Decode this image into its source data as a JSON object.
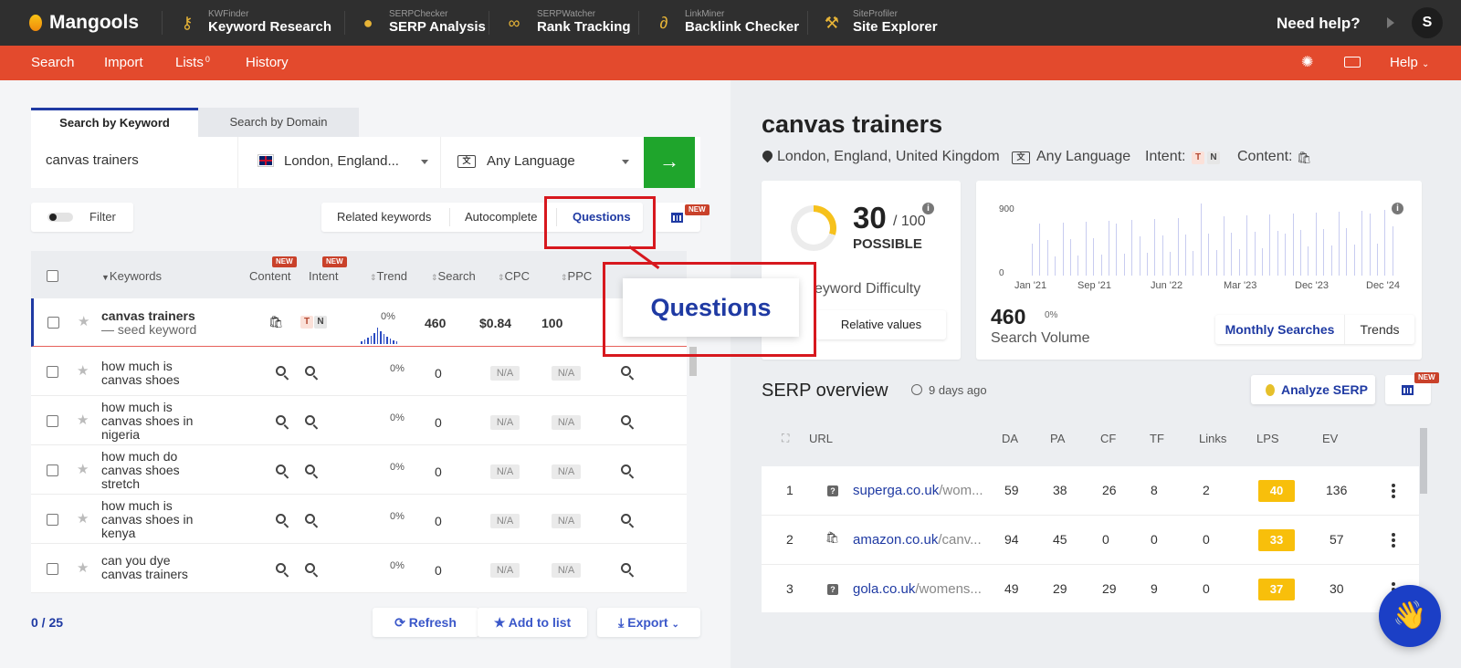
{
  "brand": "Mangools",
  "apps": [
    {
      "small": "KWFinder",
      "big": "Keyword Research"
    },
    {
      "small": "SERPChecker",
      "big": "SERP Analysis"
    },
    {
      "small": "SERPWatcher",
      "big": "Rank Tracking"
    },
    {
      "small": "LinkMiner",
      "big": "Backlink Checker"
    },
    {
      "small": "SiteProfiler",
      "big": "Site Explorer"
    }
  ],
  "need_help": "Need help?",
  "avatar_letter": "S",
  "nav": {
    "search": "Search",
    "import": "Import",
    "lists": "Lists",
    "lists_count": "0",
    "history": "History",
    "help": "Help"
  },
  "search_tabs": {
    "keyword": "Search by Keyword",
    "domain": "Search by Domain"
  },
  "search": {
    "keyword": "canvas trainers",
    "location": "London, England...",
    "language": "Any Language",
    "go": "→"
  },
  "filter_label": "Filter",
  "keyword_tabs": {
    "related": "Related keywords",
    "autocomplete": "Autocomplete",
    "questions": "Questions"
  },
  "new_badge": "NEW",
  "table_headers": {
    "keywords": "Keywords",
    "content": "Content",
    "intent": "Intent",
    "trend": "Trend",
    "search": "Search",
    "cpc": "CPC",
    "ppc": "PPC"
  },
  "rows": [
    {
      "keyword": "canvas trainers",
      "sub": "— seed keyword",
      "trend": "0%",
      "search": "460",
      "cpc": "$0.84",
      "ppc": "100"
    },
    {
      "keyword": "how much is canvas shoes",
      "trend": "0%",
      "search": "0",
      "cpc": "N/A",
      "ppc": "N/A"
    },
    {
      "keyword": "how much is canvas shoes in nigeria",
      "trend": "0%",
      "search": "0",
      "cpc": "N/A",
      "ppc": "N/A"
    },
    {
      "keyword": "how much do canvas shoes stretch",
      "trend": "0%",
      "search": "0",
      "cpc": "N/A",
      "ppc": "N/A"
    },
    {
      "keyword": "how much is canvas shoes in kenya",
      "trend": "0%",
      "search": "0",
      "cpc": "N/A",
      "ppc": "N/A"
    },
    {
      "keyword": "can you dye canvas trainers",
      "trend": "0%",
      "search": "0",
      "cpc": "N/A",
      "ppc": "N/A"
    }
  ],
  "intent_tags": {
    "t": "T",
    "n": "N"
  },
  "selection_count": "0 / 25",
  "footer_buttons": {
    "refresh": "Refresh",
    "add": "Add to list",
    "export": "Export"
  },
  "callout": "Questions",
  "detail": {
    "title": "canvas trainers",
    "location": "London, England, United Kingdom",
    "language": "Any Language",
    "intent_label": "Intent:",
    "content_label": "Content:",
    "difficulty": {
      "score": "30",
      "max": "/ 100",
      "label": "POSSIBLE",
      "caption": "eyword Difficulty",
      "button": "Relative values"
    },
    "volume": {
      "value": "460",
      "change": "0%",
      "caption": "Search Volume",
      "tab1": "Monthly Searches",
      "tab2": "Trends",
      "y_top": "900",
      "y_bottom": "0",
      "x_labels": [
        "Jan '21",
        "Sep '21",
        "Jun '22",
        "Mar '23",
        "Dec '23",
        "Dec '24"
      ]
    }
  },
  "serp": {
    "title": "SERP overview",
    "age": "9 days ago",
    "analyze": "Analyze SERP",
    "headers": {
      "url": "URL",
      "da": "DA",
      "pa": "PA",
      "cf": "CF",
      "tf": "TF",
      "links": "Links",
      "lps": "LPS",
      "ev": "EV"
    },
    "rows": [
      {
        "rank": "1",
        "domain": "superga.co.uk",
        "path": "/wom...",
        "da": "59",
        "pa": "38",
        "cf": "26",
        "tf": "8",
        "links": "2",
        "lps": "40",
        "ev": "136"
      },
      {
        "rank": "2",
        "domain": "amazon.co.uk",
        "path": "/canv...",
        "da": "94",
        "pa": "45",
        "cf": "0",
        "tf": "0",
        "links": "0",
        "lps": "33",
        "ev": "57"
      },
      {
        "rank": "3",
        "domain": "gola.co.uk",
        "path": "/womens...",
        "da": "49",
        "pa": "29",
        "cf": "29",
        "tf": "9",
        "links": "0",
        "lps": "37",
        "ev": "30"
      }
    ]
  },
  "colors": {
    "accent": "#e34a2d",
    "primary": "#1f3aa3",
    "go": "#1fa52c",
    "lps": "#f8bf0b",
    "highlight": "#d7181e"
  }
}
